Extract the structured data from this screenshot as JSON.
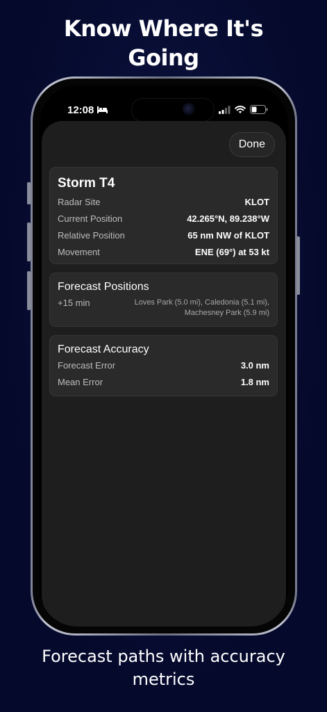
{
  "headline": "Know Where It's Going",
  "caption": "Forecast paths with accuracy metrics",
  "status_bar": {
    "time": "12:08",
    "sleep_icon": "bed-icon",
    "signal_icon": "cellular-signal-icon",
    "wifi_icon": "wifi-icon",
    "battery_icon": "battery-icon"
  },
  "sheet": {
    "done_label": "Done",
    "storm_card": {
      "title": "Storm T4",
      "rows": [
        {
          "label": "Radar Site",
          "value": "KLOT"
        },
        {
          "label": "Current Position",
          "value": "42.265°N, 89.238°W"
        },
        {
          "label": "Relative Position",
          "value": "65 nm NW of KLOT"
        },
        {
          "label": "Movement",
          "value": "ENE (69°) at 53 kt"
        }
      ]
    },
    "forecast_card": {
      "title": "Forecast Positions",
      "time": "+15 min",
      "places_line1": "Loves Park (5.0 mi), Caledonia (5.1 mi),",
      "places_line2": "Machesney Park (5.9 mi)"
    },
    "accuracy_card": {
      "title": "Forecast Accuracy",
      "rows": [
        {
          "label": "Forecast Error",
          "value": "3.0 nm"
        },
        {
          "label": "Mean Error",
          "value": "1.8 nm"
        }
      ]
    }
  },
  "colors": {
    "background": "#050a2c",
    "sheet": "#1e1e1e",
    "card": "#2a2a2a"
  }
}
